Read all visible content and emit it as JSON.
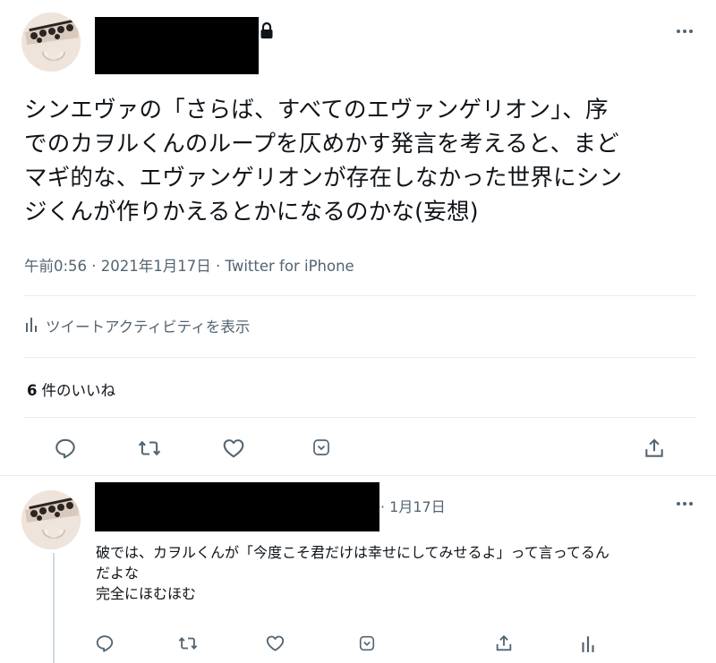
{
  "main_tweet": {
    "text_lines": [
      "シンエヴァの「さらば、すべてのエヴァンゲリオン」、序",
      "でのカヲルくんのループを仄めかす発言を考えると、まど",
      "マギ的な、エヴァンゲリオンが存在しなかった世界にシン",
      "ジくんが作りかえるとかになるのかな(妄想)"
    ],
    "meta": "午前0:56 · 2021年1月17日 · Twitter for iPhone",
    "activity_label": "ツイートアクティビティを表示",
    "likes_count": "6",
    "likes_label": "件のいいね"
  },
  "reply_tweet": {
    "date": "· 1月17日",
    "text_lines": [
      "破では、カヲルくんが「今度こそ君だけは幸せにしてみせるよ」って言ってるん",
      "だよな",
      "完全にほむほむ"
    ]
  },
  "icons": {
    "main_actions": [
      "reply-icon",
      "retweet-icon",
      "like-icon",
      "bookmark-icon",
      "share-icon"
    ],
    "reply_actions": [
      "reply-icon",
      "retweet-icon",
      "like-icon",
      "bookmark-icon",
      "share-icon",
      "analytics-icon"
    ]
  },
  "colors": {
    "text": "#0f1419",
    "secondary": "#536471",
    "divider": "#e6ecf0",
    "redaction": "#000000"
  }
}
